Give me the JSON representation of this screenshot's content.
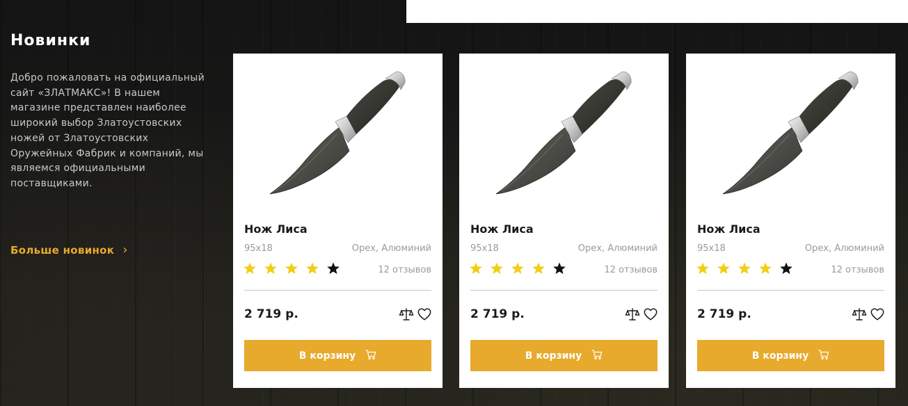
{
  "section": {
    "title": "Новинки",
    "description": "Добро пожаловать на официальный сайт «ЗЛАТМАКС»! В нашем магазине представлен наиболее широкий выбор Златоустовских ножей от Златоустовских Оружейных Фабрик и компаний, мы являемся официальными поставщиками.",
    "more_link": "Больше новинок",
    "more_icon": "chevron-right-icon"
  },
  "colors": {
    "accent": "#e7aa2c",
    "star_filled": "#f2cf16",
    "star_empty": "#111111",
    "background": "#161616"
  },
  "products": [
    {
      "name": "Нож Лиса",
      "size": "95х18",
      "material": "Орех, Алюминий",
      "rating": 4,
      "rating_max": 5,
      "reviews": "12 отзывов",
      "price": "2 719 р.",
      "cart_label": "В корзину",
      "icons": [
        "compare-icon",
        "heart-icon",
        "cart-icon"
      ]
    },
    {
      "name": "Нож Лиса",
      "size": "95х18",
      "material": "Орех, Алюминий",
      "rating": 4,
      "rating_max": 5,
      "reviews": "12 отзывов",
      "price": "2 719 р.",
      "cart_label": "В корзину",
      "icons": [
        "compare-icon",
        "heart-icon",
        "cart-icon"
      ]
    },
    {
      "name": "Нож Лиса",
      "size": "95х18",
      "material": "Орех, Алюминий",
      "rating": 4,
      "rating_max": 5,
      "reviews": "12 отзывов",
      "price": "2 719 р.",
      "cart_label": "В корзину",
      "icons": [
        "compare-icon",
        "heart-icon",
        "cart-icon"
      ]
    }
  ]
}
